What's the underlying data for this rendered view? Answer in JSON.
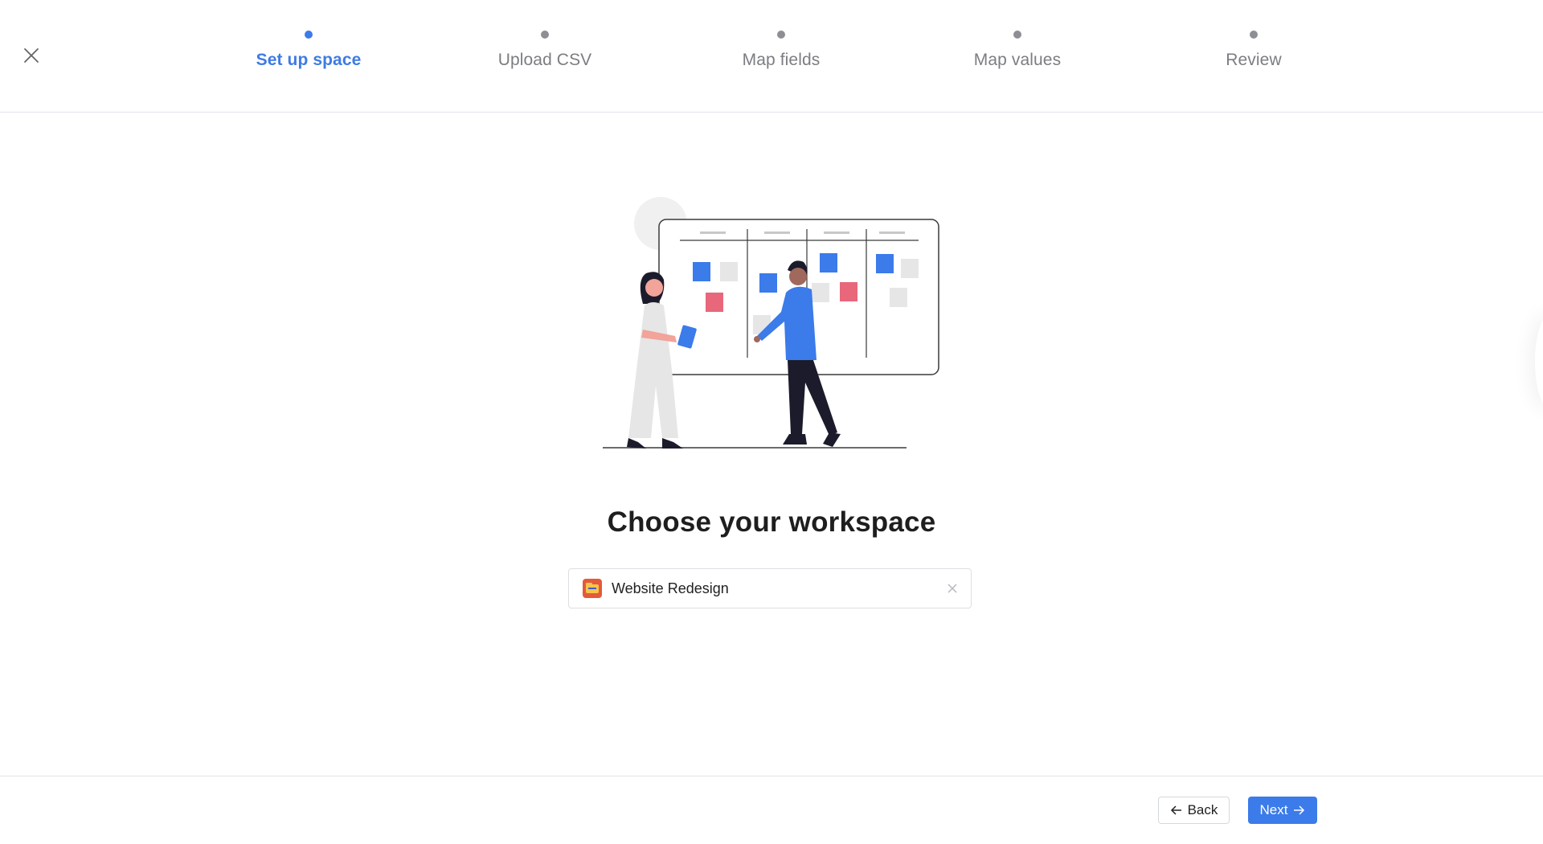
{
  "stepper": {
    "steps": [
      {
        "label": "Set up space",
        "active": true
      },
      {
        "label": "Upload CSV",
        "active": false
      },
      {
        "label": "Map fields",
        "active": false
      },
      {
        "label": "Map values",
        "active": false
      },
      {
        "label": "Review",
        "active": false
      }
    ]
  },
  "icons": {
    "close": "close-icon",
    "clear": "clear-icon",
    "back_arrow": "arrow-left-icon",
    "next_arrow": "arrow-right-icon",
    "workspace": "folder-icon"
  },
  "main": {
    "title": "Choose your workspace",
    "workspace_select": {
      "value": "Website Redesign"
    }
  },
  "footer": {
    "back_label": "Back",
    "next_label": "Next"
  },
  "colors": {
    "accent": "#3b7bea",
    "active_step": "#3e7be3",
    "inactive_step": "#7b7d82",
    "card_pink": "#e8677b",
    "card_grey": "#e6e6e6"
  }
}
